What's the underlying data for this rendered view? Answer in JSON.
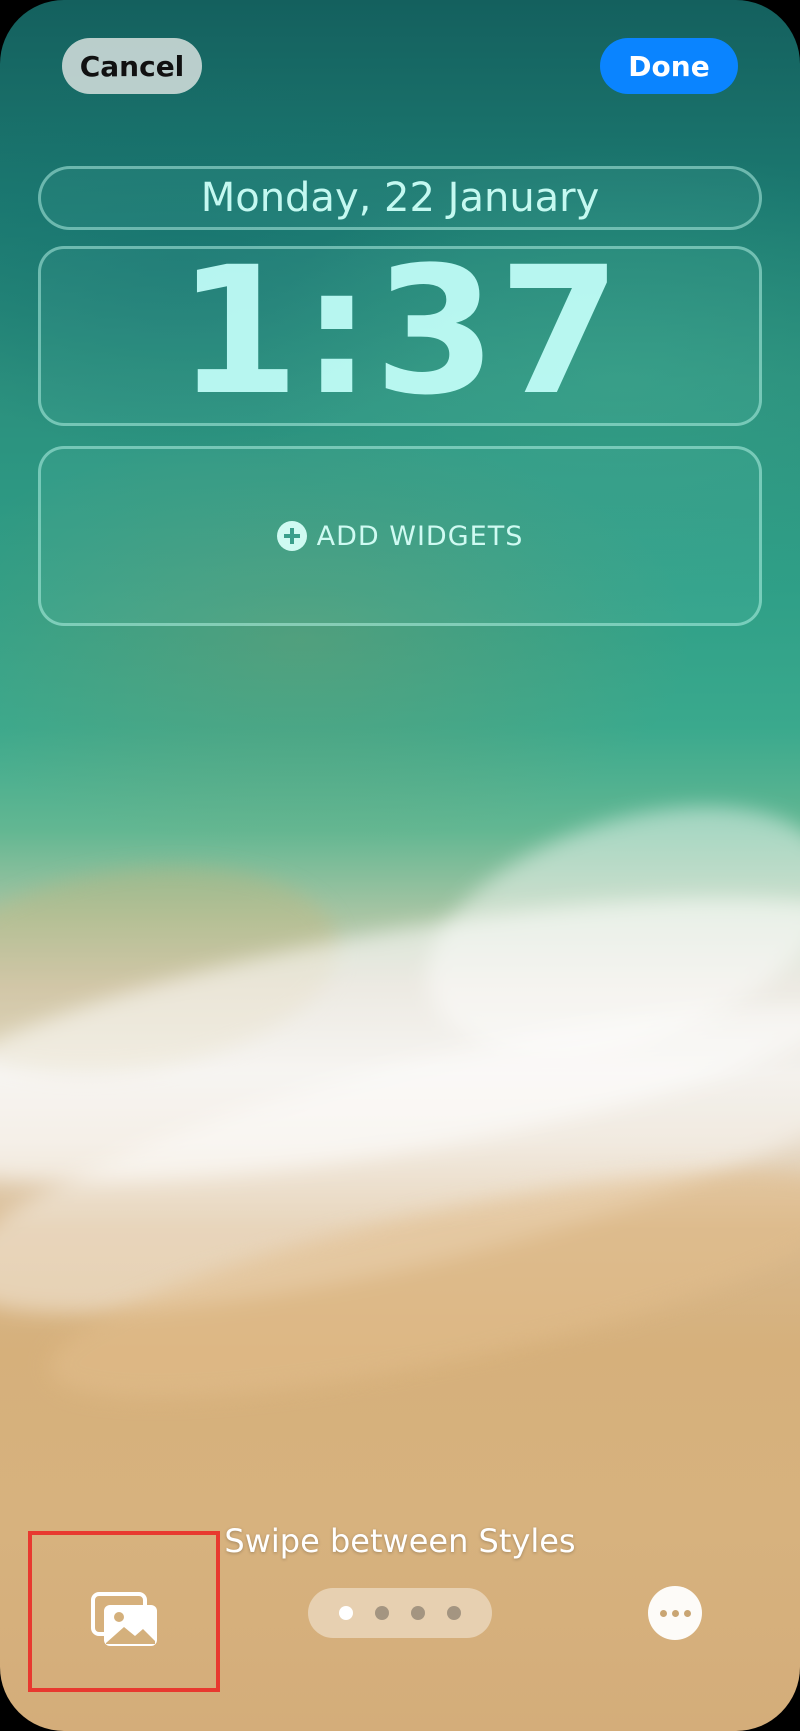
{
  "header": {
    "cancel_label": "Cancel",
    "done_label": "Done"
  },
  "lockscreen": {
    "date": "Monday, 22 January",
    "time": "1:37",
    "add_widgets_label": "ADD WIDGETS"
  },
  "footer": {
    "hint": "Swipe between Styles",
    "page_count": 4,
    "active_page": 1
  },
  "icons": {
    "add": "plus-circle-icon",
    "gallery": "photo-library-icon",
    "more": "ellipsis-circle-icon"
  },
  "colors": {
    "done_button": "#0a84ff",
    "highlight": "#e8392f"
  }
}
